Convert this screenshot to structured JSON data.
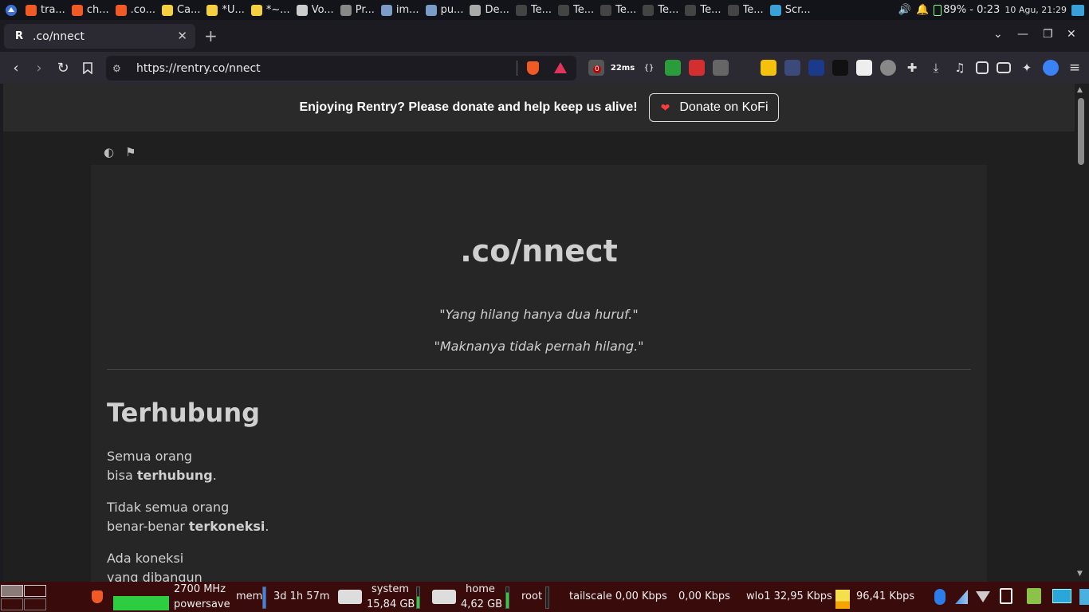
{
  "os_taskbar": {
    "tasks": [
      {
        "label": "tra...",
        "color": "#f05a24"
      },
      {
        "label": "ch...",
        "color": "#f05a24"
      },
      {
        "label": ".co...",
        "color": "#f05a24"
      },
      {
        "label": "Ca...",
        "color": "#f4d03f"
      },
      {
        "label": "*U...",
        "color": "#f4d03f"
      },
      {
        "label": "*~...",
        "color": "#f4d03f"
      },
      {
        "label": "Vo...",
        "color": "#cccccc"
      },
      {
        "label": "Pr...",
        "color": "#888888"
      },
      {
        "label": "im...",
        "color": "#7a9cc6"
      },
      {
        "label": "pu...",
        "color": "#7a9cc6"
      },
      {
        "label": "De...",
        "color": "#aaaaaa"
      },
      {
        "label": "Te...",
        "color": "#444444"
      },
      {
        "label": "Te...",
        "color": "#444444"
      },
      {
        "label": "Te...",
        "color": "#444444"
      },
      {
        "label": "Te...",
        "color": "#444444"
      },
      {
        "label": "Te...",
        "color": "#444444"
      },
      {
        "label": "Te...",
        "color": "#444444"
      },
      {
        "label": "Scr...",
        "color": "#3aa0d8"
      }
    ],
    "battery": "89% - 0:23",
    "clock": "10 Agu, 21:29"
  },
  "browser": {
    "tab_title": ".co/nnect",
    "tab_favicon": "R",
    "url": "https://rentry.co/nnect",
    "ping": "22ms",
    "badge": "0"
  },
  "page": {
    "donate_message": "Enjoying Rentry? Please donate and help keep us alive!",
    "donate_button": "Donate on KoFi",
    "title": ".co/nnect",
    "quote1": "\"Yang hilang hanya dua huruf.\"",
    "quote2": "\"Maknanya tidak pernah hilang.\"",
    "heading": "Terhubung",
    "p1_line1": "Semua orang",
    "p1_line2_pre": "bisa ",
    "p1_line2_bold": "terhubung",
    "p1_line2_post": ".",
    "p2_line1": "Tidak semua orang",
    "p2_line2_pre": "benar-benar ",
    "p2_line2_bold": "terkoneksi",
    "p2_line2_post": ".",
    "p3_line1": "Ada koneksi",
    "p3_line2": "yang dibangun"
  },
  "bottom_panel": {
    "cpu_freq": "2700 MHz",
    "cpu_governor": "powersave",
    "mem_label": "mem",
    "uptime": "3d 1h 57m",
    "disk1_name": "system",
    "disk1_free": "15,84 GB",
    "disk2_name": "home",
    "disk2_free": "4,62 GB",
    "disk3_name": "root",
    "net1": "tailscale 0,00 Kbps",
    "net2": "0,00 Kbps",
    "net3": "wlo1  32,95 Kbps",
    "net4": "96,41 Kbps"
  }
}
